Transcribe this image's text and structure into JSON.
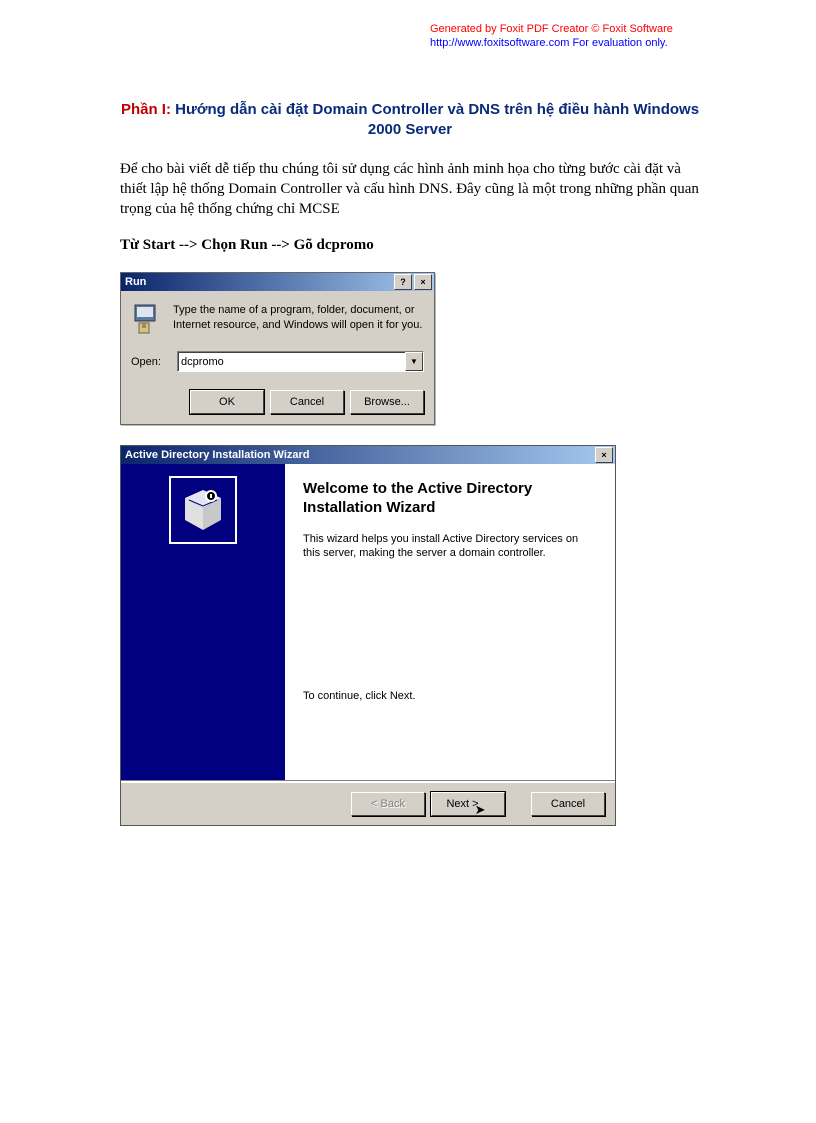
{
  "header": {
    "line1": "Generated by Foxit PDF Creator © Foxit Software",
    "line2_a": "http://www.foxitsoftware.com",
    "line2_b": "   For evaluation only."
  },
  "title": {
    "part": "Phần I:",
    "rest": " Hướng dẫn cài đặt Domain Controller và DNS trên hệ điều hành Windows 2000 Server"
  },
  "paragraph": "Để cho bài viết dễ tiếp thu chúng tôi sử dụng các hình ảnh minh họa cho từng bước cài đặt và thiết lập hệ thống Domain Controller và cấu hình DNS. Đây cũng là một trong những phần quan trọng của hệ thống chứng chỉ MCSE",
  "step": "Từ Start --> Chọn Run --> Gõ dcpromo",
  "run_dialog": {
    "title": "Run",
    "help_label": "?",
    "close_label": "×",
    "description": "Type the name of a program, folder, document, or Internet resource, and Windows will open it for you.",
    "open_label": "Open:",
    "input_value": "dcpromo",
    "dropdown_glyph": "▼",
    "ok": "OK",
    "cancel": "Cancel",
    "browse": "Browse..."
  },
  "wizard": {
    "title": "Active Directory Installation Wizard",
    "close_label": "×",
    "heading": "Welcome to the Active Directory Installation Wizard",
    "text": "This wizard helps you install Active Directory services on this server, making the server a domain controller.",
    "continue": "To continue, click Next.",
    "back": "< Back",
    "next": "Next >",
    "cancel": "Cancel"
  }
}
